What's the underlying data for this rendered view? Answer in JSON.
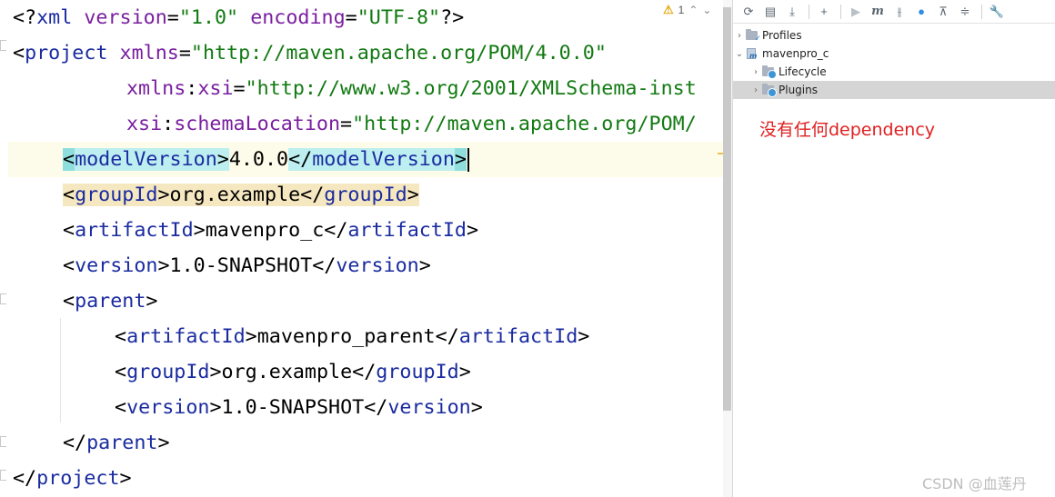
{
  "editor": {
    "inspection": {
      "warning_count": "1"
    },
    "lines": [
      {
        "parts": [
          {
            "t": "<?"
          },
          {
            "t": "xml",
            "c": "kw"
          },
          {
            "t": " "
          },
          {
            "t": "version",
            "c": "attr"
          },
          {
            "t": "="
          },
          {
            "t": "\"1.0\"",
            "c": "str"
          },
          {
            "t": " "
          },
          {
            "t": "encoding",
            "c": "attr"
          },
          {
            "t": "="
          },
          {
            "t": "\"UTF-8\"",
            "c": "str"
          },
          {
            "t": "?>"
          }
        ]
      },
      {
        "parts": [
          {
            "t": "<"
          },
          {
            "t": "project",
            "c": "tag"
          },
          {
            "t": " "
          },
          {
            "t": "xmlns",
            "c": "attr"
          },
          {
            "t": "="
          },
          {
            "t": "\"http://maven.apache.org/POM/4.0.0\"",
            "c": "str"
          }
        ]
      },
      {
        "parts": [
          {
            "t": "xmlns",
            "c": "attr"
          },
          {
            "t": ":"
          },
          {
            "t": "xsi",
            "c": "attr"
          },
          {
            "t": "="
          },
          {
            "t": "\"http://www.w3.org/2001/XMLSchema-inst",
            "c": "str"
          }
        ]
      },
      {
        "parts": [
          {
            "t": "xsi",
            "c": "attr"
          },
          {
            "t": ":"
          },
          {
            "t": "schemaLocation",
            "c": "attr"
          },
          {
            "t": "="
          },
          {
            "t": "\"http://maven.apache.org/POM/",
            "c": "str"
          }
        ]
      },
      {
        "parts": [
          {
            "t": "<"
          },
          {
            "t": "modelVersion",
            "c": "tag"
          },
          {
            "t": ">"
          },
          {
            "t": "4.0.0"
          },
          {
            "t": "</"
          },
          {
            "t": "modelVersion",
            "c": "tag"
          },
          {
            "t": ">"
          }
        ]
      },
      {
        "parts": [
          {
            "t": "<"
          },
          {
            "t": "groupId",
            "c": "tag"
          },
          {
            "t": ">"
          },
          {
            "t": "org.example"
          },
          {
            "t": "</"
          },
          {
            "t": "groupId",
            "c": "tag"
          },
          {
            "t": ">"
          }
        ]
      },
      {
        "parts": [
          {
            "t": "<"
          },
          {
            "t": "artifactId",
            "c": "tag"
          },
          {
            "t": ">"
          },
          {
            "t": "mavenpro_c"
          },
          {
            "t": "</"
          },
          {
            "t": "artifactId",
            "c": "tag"
          },
          {
            "t": ">"
          }
        ]
      },
      {
        "parts": [
          {
            "t": "<"
          },
          {
            "t": "version",
            "c": "tag"
          },
          {
            "t": ">"
          },
          {
            "t": "1.0-SNAPSHOT"
          },
          {
            "t": "</"
          },
          {
            "t": "version",
            "c": "tag"
          },
          {
            "t": ">"
          }
        ]
      },
      {
        "parts": [
          {
            "t": "<"
          },
          {
            "t": "parent",
            "c": "tag"
          },
          {
            "t": ">"
          }
        ]
      },
      {
        "parts": [
          {
            "t": "<"
          },
          {
            "t": "artifactId",
            "c": "tag"
          },
          {
            "t": ">"
          },
          {
            "t": "mavenpro_parent"
          },
          {
            "t": "</"
          },
          {
            "t": "artifactId",
            "c": "tag"
          },
          {
            "t": ">"
          }
        ]
      },
      {
        "parts": [
          {
            "t": "<"
          },
          {
            "t": "groupId",
            "c": "tag"
          },
          {
            "t": ">"
          },
          {
            "t": "org.example"
          },
          {
            "t": "</"
          },
          {
            "t": "groupId",
            "c": "tag"
          },
          {
            "t": ">"
          }
        ]
      },
      {
        "parts": [
          {
            "t": "<"
          },
          {
            "t": "version",
            "c": "tag"
          },
          {
            "t": ">"
          },
          {
            "t": "1.0-SNAPSHOT"
          },
          {
            "t": "</"
          },
          {
            "t": "version",
            "c": "tag"
          },
          {
            "t": ">"
          }
        ]
      },
      {
        "parts": [
          {
            "t": "</"
          },
          {
            "t": "parent",
            "c": "tag"
          },
          {
            "t": ">"
          }
        ]
      },
      {
        "parts": [
          {
            "t": "</"
          },
          {
            "t": "project",
            "c": "tag"
          },
          {
            "t": ">"
          }
        ]
      }
    ]
  },
  "maven": {
    "toolbar": [
      "refresh-icon",
      "add-maven-project-icon",
      "download-icon",
      "plus-icon",
      "run-icon",
      "maven-goal-icon",
      "toggle-offline-icon",
      "skip-tests-icon",
      "collapse-all-icon",
      "expand-all-icon",
      "settings-wrench-icon"
    ],
    "tree": {
      "profiles": "Profiles",
      "project": "mavenpro_c",
      "lifecycle": "Lifecycle",
      "plugins": "Plugins"
    }
  },
  "annotation": "没有任何dependency",
  "watermark": "CSDN @血莲丹",
  "colors": {
    "tag": "#1a2ba0",
    "attribute": "#7a1fa0",
    "string": "#127a12",
    "annotation": "#e02020",
    "selection": "#d5d5d5"
  }
}
